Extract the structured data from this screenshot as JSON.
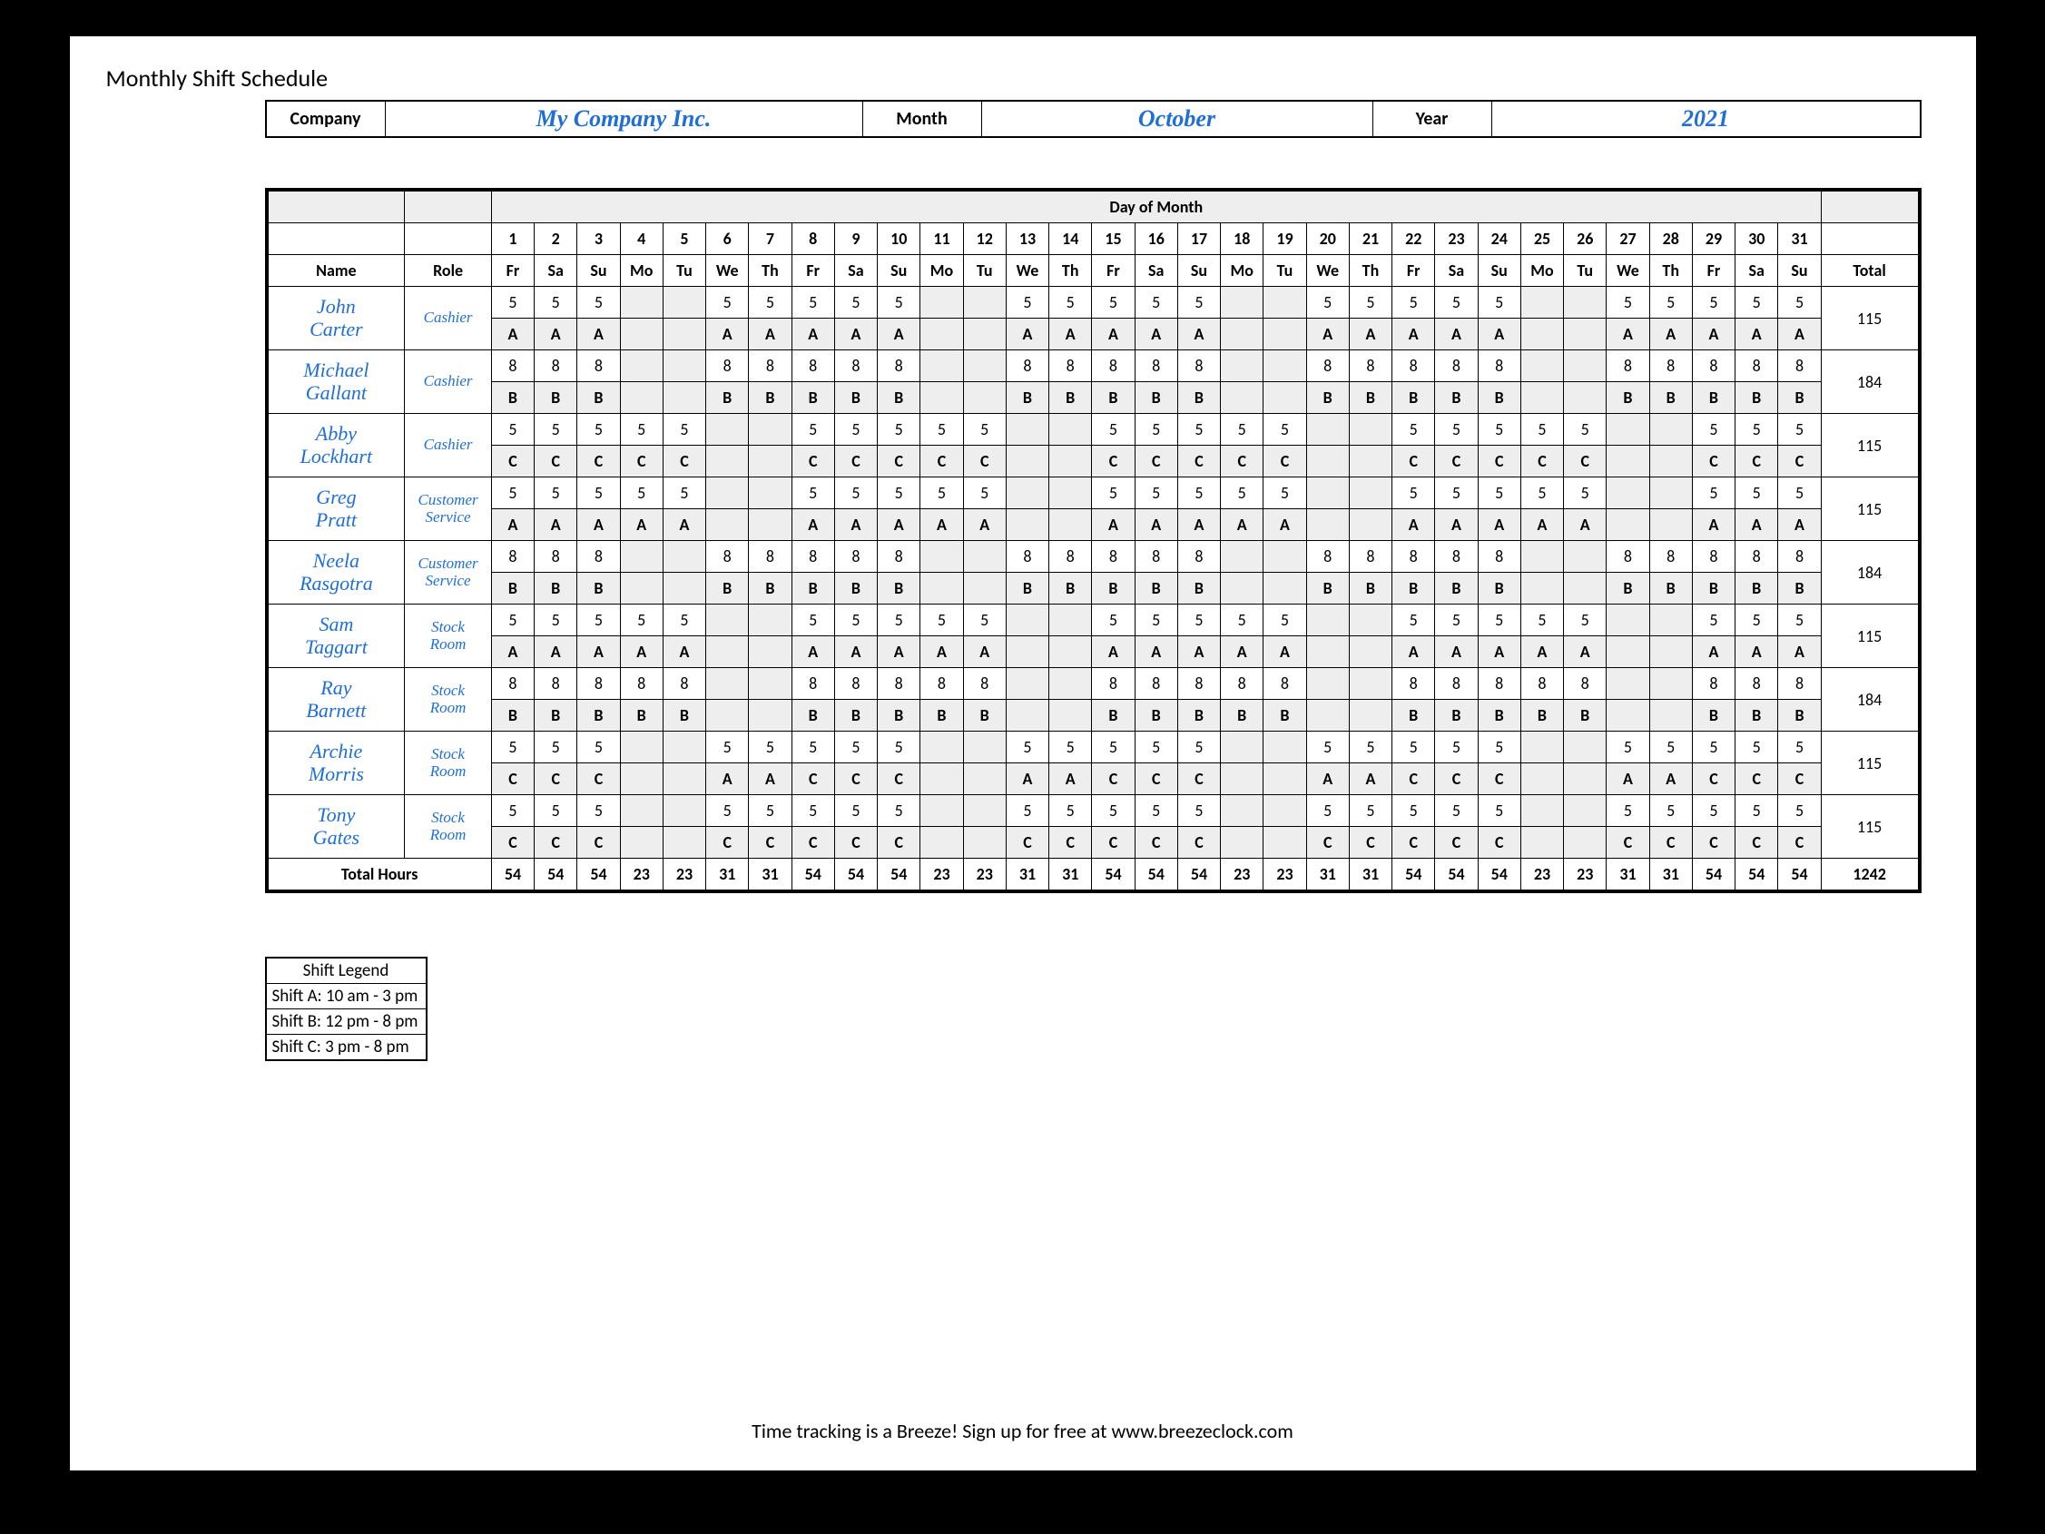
{
  "title": "Monthly Shift Schedule",
  "header": {
    "company_label": "Company",
    "company": "My Company Inc.",
    "month_label": "Month",
    "month": "October",
    "year_label": "Year",
    "year": "2021"
  },
  "grid_header": {
    "day_of_month": "Day of Month",
    "name": "Name",
    "role": "Role",
    "total": "Total"
  },
  "days": [
    1,
    2,
    3,
    4,
    5,
    6,
    7,
    8,
    9,
    10,
    11,
    12,
    13,
    14,
    15,
    16,
    17,
    18,
    19,
    20,
    21,
    22,
    23,
    24,
    25,
    26,
    27,
    28,
    29,
    30,
    31
  ],
  "dow": [
    "Fr",
    "Sa",
    "Su",
    "Mo",
    "Tu",
    "We",
    "Th",
    "Fr",
    "Sa",
    "Su",
    "Mo",
    "Tu",
    "We",
    "Th",
    "Fr",
    "Sa",
    "Su",
    "Mo",
    "Tu",
    "We",
    "Th",
    "Fr",
    "Sa",
    "Su",
    "Mo",
    "Tu",
    "We",
    "Th",
    "Fr",
    "Sa",
    "Su"
  ],
  "employees": [
    {
      "name": "John Carter",
      "role": "Cashier",
      "hours": [
        "5",
        "5",
        "5",
        "",
        "",
        "5",
        "5",
        "5",
        "5",
        "5",
        "",
        "",
        "5",
        "5",
        "5",
        "5",
        "5",
        "",
        "",
        "5",
        "5",
        "5",
        "5",
        "5",
        "",
        "",
        "5",
        "5",
        "5",
        "5",
        "5"
      ],
      "shift": [
        "A",
        "A",
        "A",
        "",
        "",
        "A",
        "A",
        "A",
        "A",
        "A",
        "",
        "",
        "A",
        "A",
        "A",
        "A",
        "A",
        "",
        "",
        "A",
        "A",
        "A",
        "A",
        "A",
        "",
        "",
        "A",
        "A",
        "A",
        "A",
        "A"
      ],
      "total": "115"
    },
    {
      "name": "Michael Gallant",
      "role": "Cashier",
      "hours": [
        "8",
        "8",
        "8",
        "",
        "",
        "8",
        "8",
        "8",
        "8",
        "8",
        "",
        "",
        "8",
        "8",
        "8",
        "8",
        "8",
        "",
        "",
        "8",
        "8",
        "8",
        "8",
        "8",
        "",
        "",
        "8",
        "8",
        "8",
        "8",
        "8"
      ],
      "shift": [
        "B",
        "B",
        "B",
        "",
        "",
        "B",
        "B",
        "B",
        "B",
        "B",
        "",
        "",
        "B",
        "B",
        "B",
        "B",
        "B",
        "",
        "",
        "B",
        "B",
        "B",
        "B",
        "B",
        "",
        "",
        "B",
        "B",
        "B",
        "B",
        "B"
      ],
      "total": "184"
    },
    {
      "name": "Abby Lockhart",
      "role": "Cashier",
      "hours": [
        "5",
        "5",
        "5",
        "5",
        "5",
        "",
        "",
        "5",
        "5",
        "5",
        "5",
        "5",
        "",
        "",
        "5",
        "5",
        "5",
        "5",
        "5",
        "",
        "",
        "5",
        "5",
        "5",
        "5",
        "5",
        "",
        "",
        "5",
        "5",
        "5"
      ],
      "shift": [
        "C",
        "C",
        "C",
        "C",
        "C",
        "",
        "",
        "C",
        "C",
        "C",
        "C",
        "C",
        "",
        "",
        "C",
        "C",
        "C",
        "C",
        "C",
        "",
        "",
        "C",
        "C",
        "C",
        "C",
        "C",
        "",
        "",
        "C",
        "C",
        "C"
      ],
      "total": "115"
    },
    {
      "name": "Greg Pratt",
      "role": "Customer Service",
      "hours": [
        "5",
        "5",
        "5",
        "5",
        "5",
        "",
        "",
        "5",
        "5",
        "5",
        "5",
        "5",
        "",
        "",
        "5",
        "5",
        "5",
        "5",
        "5",
        "",
        "",
        "5",
        "5",
        "5",
        "5",
        "5",
        "",
        "",
        "5",
        "5",
        "5"
      ],
      "shift": [
        "A",
        "A",
        "A",
        "A",
        "A",
        "",
        "",
        "A",
        "A",
        "A",
        "A",
        "A",
        "",
        "",
        "A",
        "A",
        "A",
        "A",
        "A",
        "",
        "",
        "A",
        "A",
        "A",
        "A",
        "A",
        "",
        "",
        "A",
        "A",
        "A"
      ],
      "total": "115"
    },
    {
      "name": "Neela Rasgotra",
      "role": "Customer Service",
      "hours": [
        "8",
        "8",
        "8",
        "",
        "",
        "8",
        "8",
        "8",
        "8",
        "8",
        "",
        "",
        "8",
        "8",
        "8",
        "8",
        "8",
        "",
        "",
        "8",
        "8",
        "8",
        "8",
        "8",
        "",
        "",
        "8",
        "8",
        "8",
        "8",
        "8"
      ],
      "shift": [
        "B",
        "B",
        "B",
        "",
        "",
        "B",
        "B",
        "B",
        "B",
        "B",
        "",
        "",
        "B",
        "B",
        "B",
        "B",
        "B",
        "",
        "",
        "B",
        "B",
        "B",
        "B",
        "B",
        "",
        "",
        "B",
        "B",
        "B",
        "B",
        "B"
      ],
      "total": "184"
    },
    {
      "name": "Sam Taggart",
      "role": "Stock Room",
      "hours": [
        "5",
        "5",
        "5",
        "5",
        "5",
        "",
        "",
        "5",
        "5",
        "5",
        "5",
        "5",
        "",
        "",
        "5",
        "5",
        "5",
        "5",
        "5",
        "",
        "",
        "5",
        "5",
        "5",
        "5",
        "5",
        "",
        "",
        "5",
        "5",
        "5"
      ],
      "shift": [
        "A",
        "A",
        "A",
        "A",
        "A",
        "",
        "",
        "A",
        "A",
        "A",
        "A",
        "A",
        "",
        "",
        "A",
        "A",
        "A",
        "A",
        "A",
        "",
        "",
        "A",
        "A",
        "A",
        "A",
        "A",
        "",
        "",
        "A",
        "A",
        "A"
      ],
      "total": "115"
    },
    {
      "name": "Ray Barnett",
      "role": "Stock Room",
      "hours": [
        "8",
        "8",
        "8",
        "8",
        "8",
        "",
        "",
        "8",
        "8",
        "8",
        "8",
        "8",
        "",
        "",
        "8",
        "8",
        "8",
        "8",
        "8",
        "",
        "",
        "8",
        "8",
        "8",
        "8",
        "8",
        "",
        "",
        "8",
        "8",
        "8"
      ],
      "shift": [
        "B",
        "B",
        "B",
        "B",
        "B",
        "",
        "",
        "B",
        "B",
        "B",
        "B",
        "B",
        "",
        "",
        "B",
        "B",
        "B",
        "B",
        "B",
        "",
        "",
        "B",
        "B",
        "B",
        "B",
        "B",
        "",
        "",
        "B",
        "B",
        "B"
      ],
      "total": "184"
    },
    {
      "name": "Archie Morris",
      "role": "Stock Room",
      "hours": [
        "5",
        "5",
        "5",
        "",
        "",
        "5",
        "5",
        "5",
        "5",
        "5",
        "",
        "",
        "5",
        "5",
        "5",
        "5",
        "5",
        "",
        "",
        "5",
        "5",
        "5",
        "5",
        "5",
        "",
        "",
        "5",
        "5",
        "5",
        "5",
        "5"
      ],
      "shift": [
        "C",
        "C",
        "C",
        "",
        "",
        "A",
        "A",
        "C",
        "C",
        "C",
        "",
        "",
        "A",
        "A",
        "C",
        "C",
        "C",
        "",
        "",
        "A",
        "A",
        "C",
        "C",
        "C",
        "",
        "",
        "A",
        "A",
        "C",
        "C",
        "C"
      ],
      "total": "115"
    },
    {
      "name": "Tony Gates",
      "role": "Stock Room",
      "hours": [
        "5",
        "5",
        "5",
        "",
        "",
        "5",
        "5",
        "5",
        "5",
        "5",
        "",
        "",
        "5",
        "5",
        "5",
        "5",
        "5",
        "",
        "",
        "5",
        "5",
        "5",
        "5",
        "5",
        "",
        "",
        "5",
        "5",
        "5",
        "5",
        "5"
      ],
      "shift": [
        "C",
        "C",
        "C",
        "",
        "",
        "C",
        "C",
        "C",
        "C",
        "C",
        "",
        "",
        "C",
        "C",
        "C",
        "C",
        "C",
        "",
        "",
        "C",
        "C",
        "C",
        "C",
        "C",
        "",
        "",
        "C",
        "C",
        "C",
        "C",
        "C"
      ],
      "total": "115"
    }
  ],
  "total_hours_label": "Total Hours",
  "daily_totals": [
    "54",
    "54",
    "54",
    "23",
    "23",
    "31",
    "31",
    "54",
    "54",
    "54",
    "23",
    "23",
    "31",
    "31",
    "54",
    "54",
    "54",
    "23",
    "23",
    "31",
    "31",
    "54",
    "54",
    "54",
    "23",
    "23",
    "31",
    "31",
    "54",
    "54",
    "54"
  ],
  "grand_total": "1242",
  "legend": {
    "title": "Shift Legend",
    "items": [
      "Shift A: 10 am - 3 pm",
      "Shift B: 12 pm - 8 pm",
      "Shift C: 3 pm - 8 pm"
    ]
  },
  "footer": "Time tracking is a Breeze! Sign up for free at www.breezeclock.com"
}
